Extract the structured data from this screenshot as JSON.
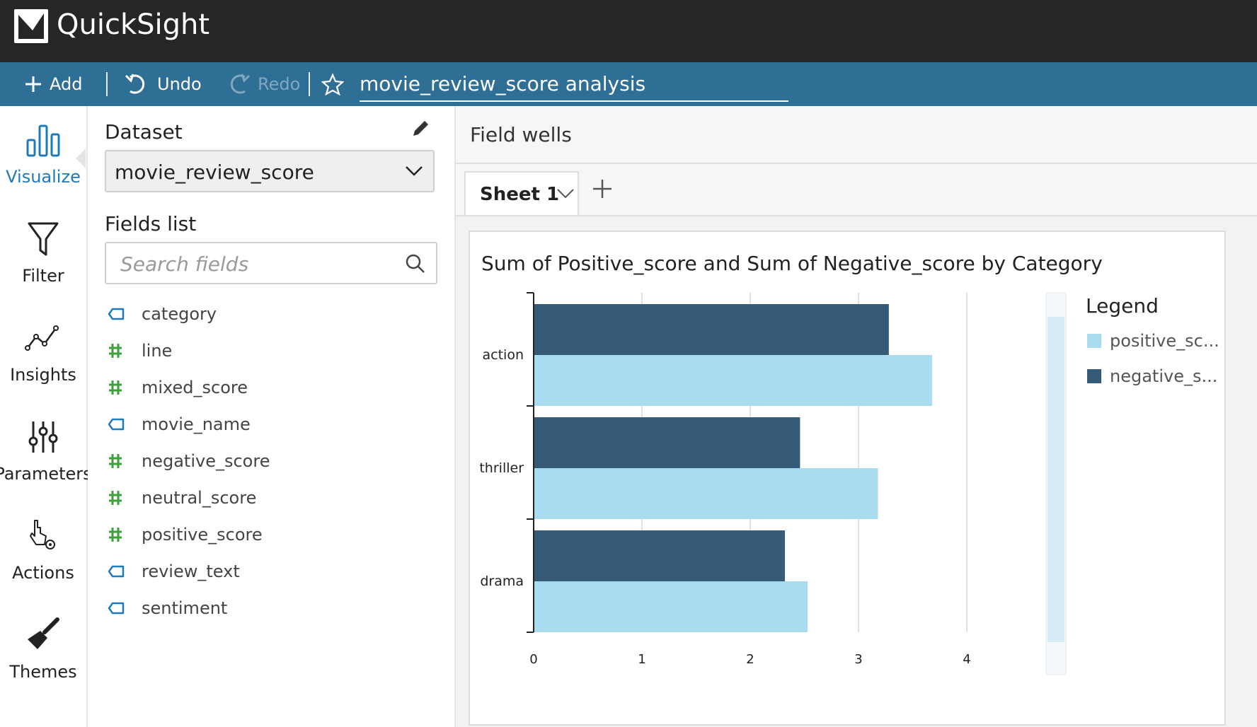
{
  "app": {
    "title": "QuickSight"
  },
  "toolbar": {
    "add_label": "Add",
    "undo_label": "Undo",
    "redo_label": "Redo",
    "analysis_name": "movie_review_score analysis"
  },
  "nav": {
    "items": [
      {
        "id": "visualize",
        "label": "Visualize",
        "icon": "bar-chart-icon",
        "active": true
      },
      {
        "id": "filter",
        "label": "Filter",
        "icon": "funnel-icon"
      },
      {
        "id": "insights",
        "label": "Insights",
        "icon": "line-graph-icon"
      },
      {
        "id": "parameters",
        "label": "Parameters",
        "icon": "sliders-icon"
      },
      {
        "id": "actions",
        "label": "Actions",
        "icon": "pointer-gear-icon"
      },
      {
        "id": "themes",
        "label": "Themes",
        "icon": "paintbrush-icon"
      }
    ]
  },
  "datapanel": {
    "dataset_heading": "Dataset",
    "dataset_value": "movie_review_score",
    "fields_heading": "Fields list",
    "search_placeholder": "Search fields",
    "fields": [
      {
        "name": "category",
        "type": "dimension"
      },
      {
        "name": "line",
        "type": "measure"
      },
      {
        "name": "mixed_score",
        "type": "measure"
      },
      {
        "name": "movie_name",
        "type": "dimension"
      },
      {
        "name": "negative_score",
        "type": "measure"
      },
      {
        "name": "neutral_score",
        "type": "measure"
      },
      {
        "name": "positive_score",
        "type": "measure"
      },
      {
        "name": "review_text",
        "type": "dimension"
      },
      {
        "name": "sentiment",
        "type": "dimension"
      }
    ]
  },
  "main": {
    "field_wells_label": "Field wells",
    "sheet_tab_label": "Sheet 1"
  },
  "legend": {
    "title": "Legend",
    "items": [
      {
        "label": "positive_sc...",
        "color": "#a9dcef"
      },
      {
        "label": "negative_s...",
        "color": "#365b78"
      }
    ]
  },
  "colors": {
    "topbar": "#262626",
    "toolbar": "#2f6f95",
    "accent": "#1e7bb7",
    "measure_icon": "#3da13d",
    "dimension_icon": "#1e7bb7",
    "positive": "#a9dcef",
    "negative": "#365b78"
  },
  "chart_data": {
    "type": "bar",
    "orientation": "horizontal",
    "title": "Sum of Positive_score and Sum of Negative_score by Category",
    "categories": [
      "action",
      "thriller",
      "drama"
    ],
    "series": [
      {
        "name": "negative_score",
        "values": [
          3.28,
          2.46,
          2.32
        ],
        "color": "#365b78"
      },
      {
        "name": "positive_score",
        "values": [
          3.68,
          3.18,
          2.53
        ],
        "color": "#a9dcef"
      }
    ],
    "xlim": [
      0,
      4
    ],
    "xticks": [
      "0",
      "1",
      "2",
      "3",
      "4"
    ],
    "grid": true,
    "legend_position": "right"
  }
}
